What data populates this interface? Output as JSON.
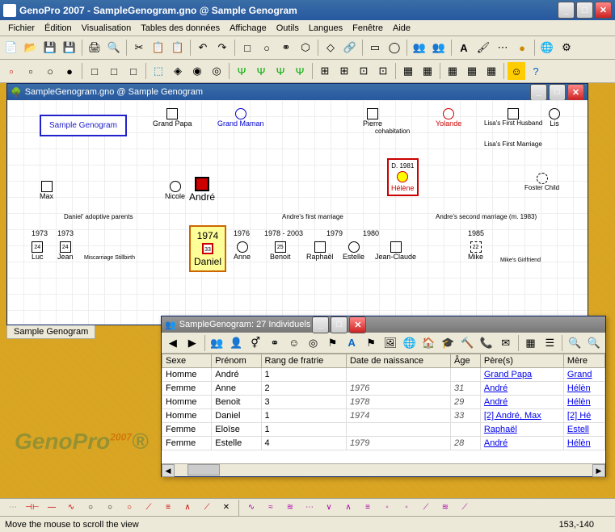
{
  "window": {
    "title": "GenoPro 2007 - SampleGenogram.gno @ Sample Genogram"
  },
  "menu": {
    "fichier": "Fichier",
    "edition": "Édition",
    "visualisation": "Visualisation",
    "tables": "Tables des données",
    "affichage": "Affichage",
    "outils": "Outils",
    "langues": "Langues",
    "fenetre": "Fenêtre",
    "aide": "Aide"
  },
  "document": {
    "title": "SampleGenogram.gno @ Sample Genogram"
  },
  "canvas": {
    "legend": "Sample Genogram",
    "nodes": {
      "grand_papa": "Grand\nPapa",
      "grand_maman": "Grand\nMaman",
      "pierre": "Pierre",
      "cohab": "cohabitation",
      "yolande": "Yolande",
      "lisa_husband": "Lisa's First\nHusband",
      "lis": "Lis",
      "lisa_marriage": "Lisa's First Marriage",
      "foster": "Foster\nChild",
      "max": "Max",
      "nicole": "Nicole",
      "andre": "André",
      "helene": "Hélène",
      "d1981": "D. 1981",
      "adoptive": "Daniel' adoptive parents",
      "first_marriage": "Andre's first marriage",
      "second_marriage": "Andre's second marriage (m. 1983)",
      "y1973a": "1973",
      "y1973b": "1973",
      "y1974": "1974",
      "y1976": "1976",
      "y1978": "1978 - 2003",
      "y1979": "1979",
      "y1980": "1980",
      "y1985": "1985",
      "luc": "Luc",
      "jean": "Jean",
      "miscarriage": "Miscarriage Stillbirth",
      "daniel": "Daniel",
      "anne": "Anne",
      "benoit": "Benoit",
      "raphael": "Raphaël",
      "estelle": "Estelle",
      "jeanclaude": "Jean-Claude",
      "mike": "Mike",
      "mike_gf": "Mike's Girlfriend",
      "age33": "33",
      "age24a": "24",
      "age24b": "24",
      "age25": "25",
      "age22": "22"
    }
  },
  "tab": {
    "label": "Sample Genogram"
  },
  "table_window": {
    "title": "SampleGenogram: 27 Individuels",
    "columns": [
      "Sexe",
      "Prénom",
      "Rang de fratrie",
      "Date de naissance",
      "Âge",
      "Père(s)",
      "Mère"
    ],
    "rows": [
      {
        "sexe": "Homme",
        "prenom": "André",
        "rang": "1",
        "dob": "",
        "age": "",
        "pere": "Grand Papa",
        "mere": "Grand"
      },
      {
        "sexe": "Femme",
        "prenom": "Anne",
        "rang": "2",
        "dob": "1976",
        "age": "31",
        "pere": "André",
        "mere": "Hélèn"
      },
      {
        "sexe": "Homme",
        "prenom": "Benoit",
        "rang": "3",
        "dob": "1978",
        "age": "29",
        "pere": "André",
        "mere": "Hélèn"
      },
      {
        "sexe": "Homme",
        "prenom": "Daniel",
        "rang": "1",
        "dob": "1974",
        "age": "33",
        "pere": "[2] André, Max",
        "mere": "[2] Hé"
      },
      {
        "sexe": "Femme",
        "prenom": "Eloïse",
        "rang": "1",
        "dob": "",
        "age": "",
        "pere": "Raphaël",
        "mere": "Estell"
      },
      {
        "sexe": "Femme",
        "prenom": "Estelle",
        "rang": "4",
        "dob": "1979",
        "age": "28",
        "pere": "André",
        "mere": "Hélèn"
      }
    ]
  },
  "status": {
    "hint": "Move the mouse to scroll the view",
    "coords": "153,-140"
  },
  "logo": {
    "text": "GenoPro",
    "year": "2007",
    "reg": "®"
  }
}
